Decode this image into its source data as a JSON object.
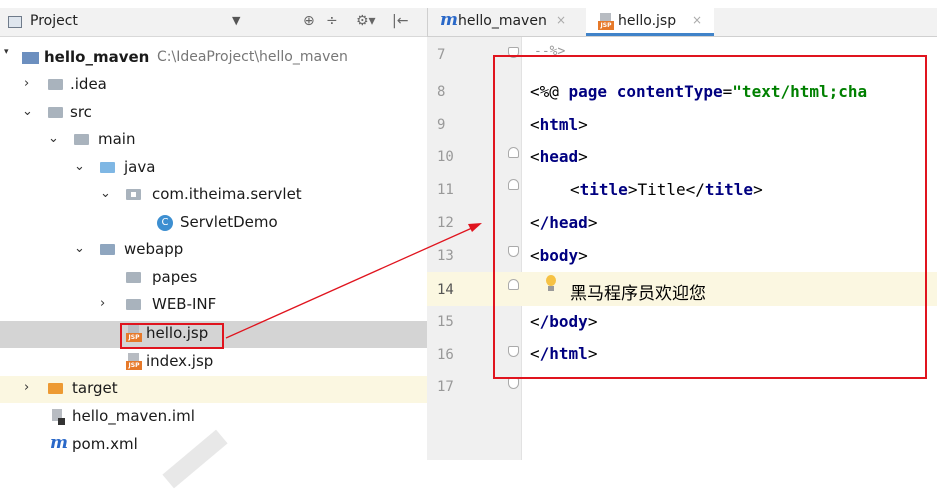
{
  "project_panel": {
    "title": "Project",
    "dropdown_glyph": "▼",
    "toolbar": {
      "sync_glyph": "⊕",
      "collapse_glyph": "÷",
      "settings_glyph": "⚙▾",
      "hide_glyph": "|←"
    },
    "tree": {
      "root_name": "hello_maven",
      "root_path": "C:\\IdeaProject\\hello_maven",
      "idea": ".idea",
      "src": "src",
      "main": "main",
      "java": "java",
      "package": "com.itheima.servlet",
      "servlet_class": "ServletDemo",
      "class_badge": "C",
      "webapp": "webapp",
      "papes": "papes",
      "web_inf": "WEB-INF",
      "hello_jsp": "hello.jsp",
      "index_jsp": "index.jsp",
      "target": "target",
      "iml": "hello_maven.iml",
      "pom": "pom.xml"
    }
  },
  "editor": {
    "tabs": [
      {
        "label": "hello_maven",
        "icon": "maven-m-icon",
        "close": "×"
      },
      {
        "label": "hello.jsp",
        "icon": "jsp-file-icon",
        "close": "×"
      }
    ],
    "line_numbers": [
      "7",
      "8",
      "9",
      "10",
      "11",
      "12",
      "13",
      "14",
      "15",
      "16",
      "17"
    ],
    "lines": {
      "l7": "--%>",
      "l8_directive_open": "<%@ ",
      "l8_kw1": "page",
      "l8_attr": " contentType",
      "l8_eq": "=",
      "l8_val": "\"text/html;cha",
      "l9_tag": "html",
      "l10_tag": "head",
      "l11_tag_open": "title",
      "l11_text": "Title",
      "l11_tag_close": "title",
      "l12_tag": "/head",
      "l13_tag": "body",
      "l14_text": "黑马程序员欢迎您",
      "l15_tag": "/body",
      "l16_tag": "/html"
    }
  },
  "colors": {
    "annotation_red": "#e0141e",
    "tag_blue": "#000080",
    "string_green": "#008000",
    "current_line": "#fbf7e1"
  }
}
